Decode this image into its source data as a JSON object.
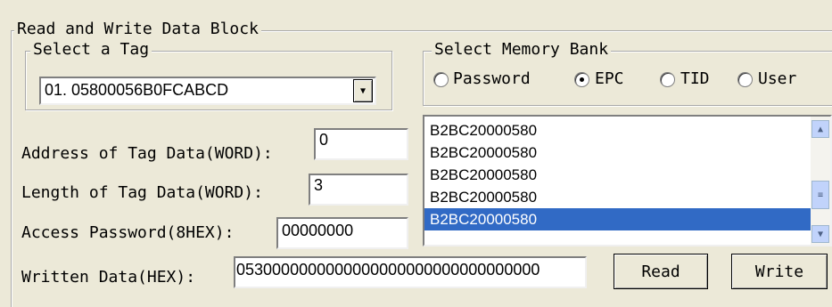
{
  "group_title": "Read and Write Data Block",
  "select_tag": {
    "legend": "Select a Tag",
    "selected": "01. 05800056B0FCABCD"
  },
  "memory_bank": {
    "legend": "Select Memory Bank",
    "options": [
      "Password",
      "EPC",
      "TID",
      "User"
    ],
    "selected": "EPC"
  },
  "address": {
    "label": "Address of Tag Data(WORD):",
    "value": "0"
  },
  "length": {
    "label": "Length of Tag Data(WORD):",
    "value": "3"
  },
  "password": {
    "label": "Access Password(8HEX):",
    "value": "00000000"
  },
  "written": {
    "label": "Written Data(HEX):",
    "value": "0530000000000000000000000000000000"
  },
  "data_list": {
    "items": [
      "B2BC20000580",
      "B2BC20000580",
      "B2BC20000580",
      "B2BC20000580",
      "B2BC20000580"
    ],
    "selected_index": 4
  },
  "buttons": {
    "read": "Read",
    "write": "Write"
  },
  "icons": {
    "dropdown": "chevron-down-icon",
    "scroll_up": "chevron-up-icon",
    "scroll_down": "chevron-down-icon"
  },
  "colors": {
    "selection": "#316ac5",
    "background": "#ece9d8"
  }
}
